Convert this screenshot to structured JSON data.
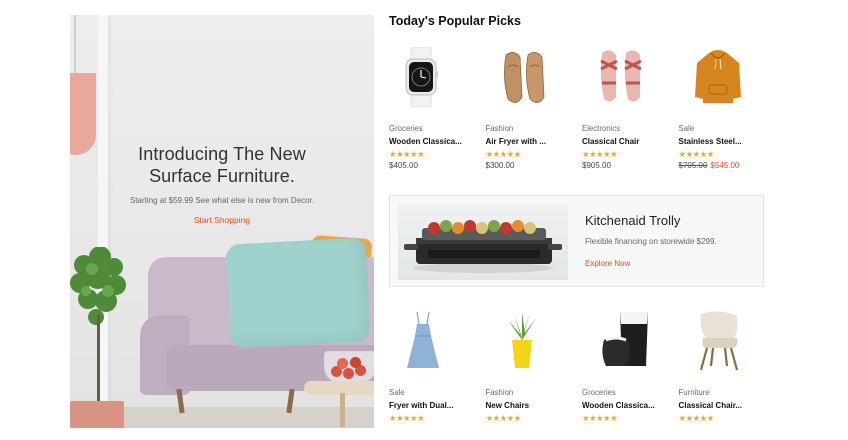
{
  "hero": {
    "title_line1": "Introducing The New",
    "title_line2": "Surface Furniture.",
    "subtitle": "Starting at $59.99 See what else is new from Decor.",
    "cta": "Start Shopping"
  },
  "section_title": "Today's Popular Picks",
  "products_top": [
    {
      "category": "Groceries",
      "name": "Wooden Classica...",
      "rating": 5,
      "stars": "★★★★★",
      "price": "$405.00",
      "icon": "smartwatch-icon"
    },
    {
      "category": "Fashion",
      "name": "Air Fryer with ...",
      "rating": 5,
      "stars": "★★★★★",
      "price": "$300.00",
      "icon": "loafers-icon"
    },
    {
      "category": "Electronics",
      "name": "Classical Chair",
      "rating": 5,
      "stars": "★★★★★",
      "price": "$905.00",
      "icon": "sandals-icon"
    },
    {
      "category": "Sale",
      "name": "Stainless Steel...",
      "rating": 5,
      "stars": "★★★★★",
      "old_price": "$705.00",
      "new_price": "$545.00",
      "icon": "hoodie-icon"
    }
  ],
  "promo": {
    "title": "Kitchenaid Trolly",
    "subtitle": "Flexible financing on storewide $299.",
    "cta": "Explore Now",
    "icon": "grill-icon"
  },
  "products_bottom": [
    {
      "category": "Sale",
      "name": "Fryer with Dual...",
      "rating": 5,
      "stars": "★★★★★",
      "icon": "dress-icon"
    },
    {
      "category": "Fashion",
      "name": "New Chairs",
      "rating": 5,
      "stars": "★★★★★",
      "icon": "potted-plant-icon"
    },
    {
      "category": "Groceries",
      "name": "Wooden Classica...",
      "rating": 5,
      "stars": "★★★★★",
      "icon": "vase-icon"
    },
    {
      "category": "Furniture",
      "name": "Classical Chair...",
      "rating": 5,
      "stars": "★★★★★",
      "icon": "chair-icon"
    }
  ],
  "colors": {
    "accent": "#e5511e",
    "star": "#f5a623"
  }
}
